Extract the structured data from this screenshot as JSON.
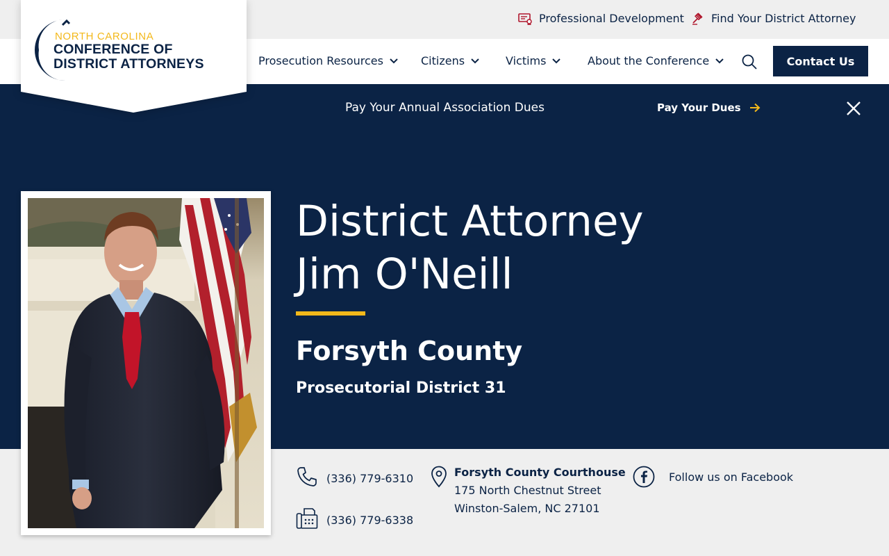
{
  "utility": {
    "professional_development": "Professional Development",
    "find_da": "Find Your District Attorney"
  },
  "logo": {
    "line1": "NORTH CAROLINA",
    "line2": "CONFERENCE OF",
    "line3": "DISTRICT ATTORNEYS"
  },
  "nav": {
    "items": [
      {
        "label": "Prosecution Resources"
      },
      {
        "label": "Citizens"
      },
      {
        "label": "Victims"
      },
      {
        "label": "About the Conference"
      }
    ],
    "contact_label": "Contact Us"
  },
  "announcement": {
    "text": "Pay Your Annual Association Dues",
    "link_label": "Pay Your Dues"
  },
  "hero": {
    "title_line1": "District Attorney",
    "title_line2": "Jim O'Neill",
    "county": "Forsyth County",
    "district": "Prosecutorial District 31"
  },
  "contact": {
    "phone": "(336) 779-6310",
    "fax": "(336) 779-6338",
    "address_title": "Forsyth County Courthouse",
    "address_line1": "175 North Chestnut Street",
    "address_line2": "Winston-Salem, NC 27101",
    "facebook": "Follow us on Facebook"
  },
  "icons": {
    "professional_development": "certificate-icon",
    "find_da": "gavel-icon",
    "nav_dropdown": "chevron-down-icon",
    "search": "search-icon",
    "announcement_link": "arrow-right-icon",
    "close": "close-icon",
    "phone": "phone-icon",
    "fax": "fax-icon",
    "address": "map-pin-icon",
    "facebook": "facebook-icon"
  },
  "colors": {
    "navy": "#0b2345",
    "gold": "#f3b81a",
    "light_gray": "#efefef",
    "accent_red": "#b0172d"
  }
}
